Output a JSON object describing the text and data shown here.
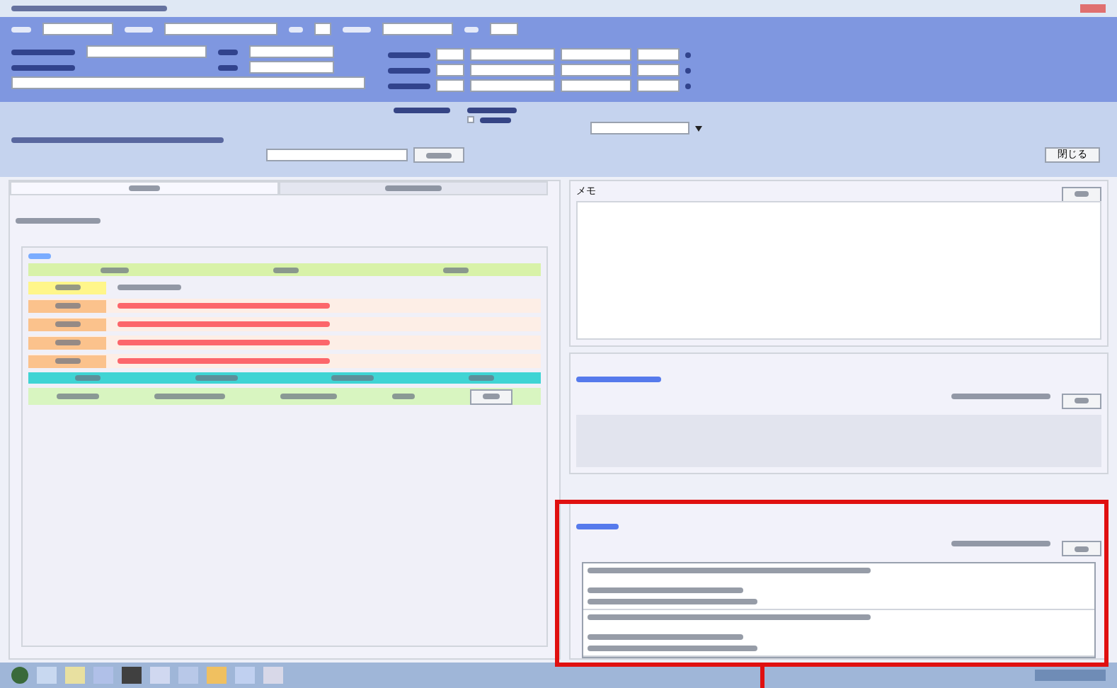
{
  "window": {
    "close_label": "閉じる"
  },
  "tabs": [
    {
      "selected": true
    },
    {
      "selected": false
    }
  ],
  "left_rows": [
    {
      "kind": "green-header"
    },
    {
      "kind": "yellow"
    },
    {
      "kind": "orange"
    },
    {
      "kind": "orange"
    },
    {
      "kind": "orange"
    },
    {
      "kind": "orange"
    },
    {
      "kind": "cyan-header"
    },
    {
      "kind": "green-data"
    }
  ],
  "memo": {
    "title": "メモ"
  },
  "messages": [
    {
      "kind": "entry"
    },
    {
      "kind": "entry"
    }
  ],
  "highlight": {
    "on": true
  },
  "search": {
    "option_checked": false
  }
}
